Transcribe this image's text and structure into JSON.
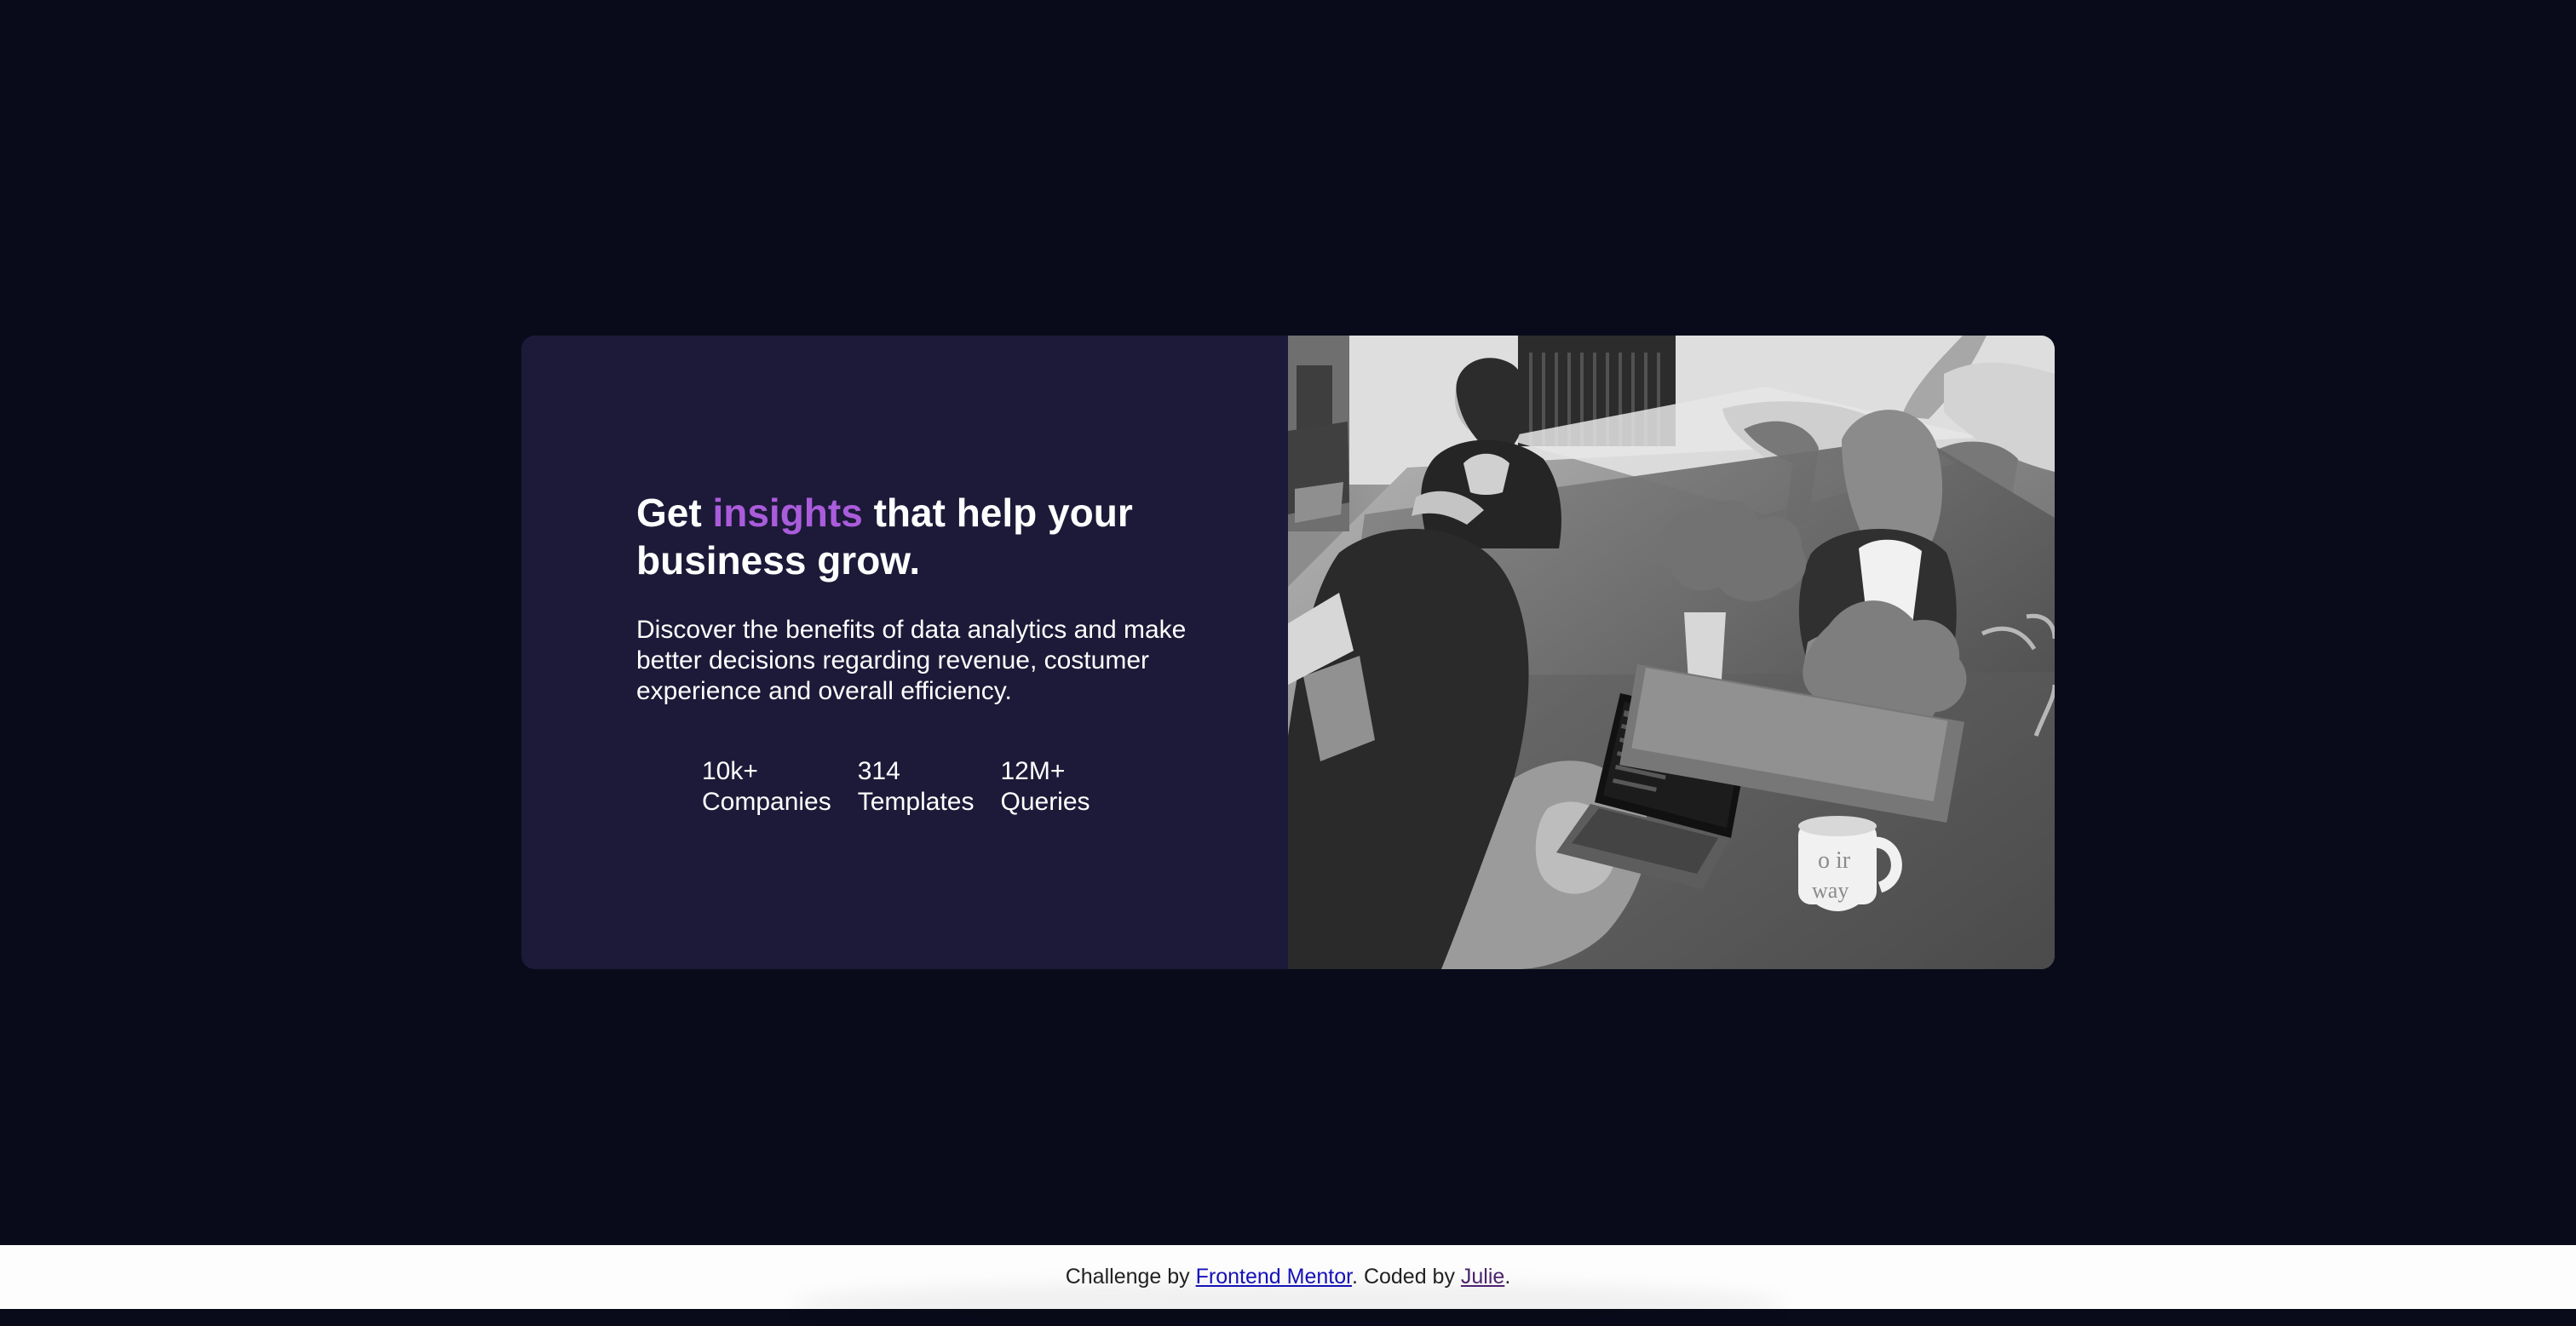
{
  "hero": {
    "headline_part1": "Get ",
    "headline_accent": "insights",
    "headline_part2": " that help your business grow.",
    "description": "Discover the benefits of data analytics and make better decisions regarding revenue, costumer experience and overall efficiency.",
    "stats": [
      {
        "value": "10k+",
        "label": "Companies"
      },
      {
        "value": "314",
        "label": "Templates"
      },
      {
        "value": "12M+",
        "label": "Queries"
      }
    ]
  },
  "image": {
    "subject": "three women working at desks with laptops, monochrome"
  },
  "footer": {
    "prefix": "Challenge by ",
    "challenge_link": "Frontend Mentor",
    "middle": ". Coded by ",
    "author_link": "Julie",
    "suffix": "."
  },
  "colors": {
    "page_background": "#090b1a",
    "card_background": "#1c1a38",
    "accent": "#aa5cdb",
    "text": "#ffffff",
    "footer_background": "#fdfdfd",
    "footer_link": "#1511b8",
    "footer_author_link": "#4d226e"
  }
}
